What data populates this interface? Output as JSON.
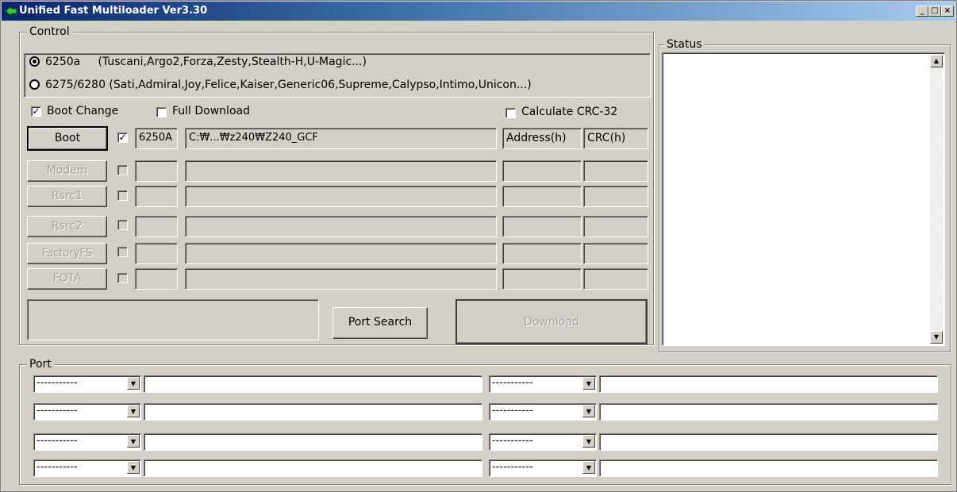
{
  "window": {
    "title": "Unified Fast Multiloader Ver3.30",
    "minimize": "_",
    "maximize": "□",
    "close": "×"
  },
  "control": {
    "legend": "Control",
    "radios": [
      {
        "label": "6250a     (Tuscani,Argo2,Forza,Zesty,Stealth-H,U-Magic...)",
        "selected": true
      },
      {
        "label": "6275/6280 (Sati,Admiral,Joy,Felice,Kaiser,Generic06,Supreme,Calypso,Intimo,Unicon...)",
        "selected": false
      }
    ],
    "boot_change": {
      "label": "Boot Change",
      "checked": true
    },
    "full_download": {
      "label": "Full Download",
      "checked": false
    },
    "calc_crc": {
      "label": "Calculate CRC-32",
      "checked": false
    },
    "header": {
      "address": "Address(h)",
      "crc": "CRC(h)"
    },
    "rows": [
      {
        "button": "Boot",
        "enabled": true,
        "checked": true,
        "chip": "6250A",
        "path": "C:₩...₩z240₩Z240_GCF",
        "address": "",
        "crc": ""
      },
      {
        "button": "Modem",
        "enabled": false,
        "checked": false,
        "chip": "",
        "path": "",
        "address": "",
        "crc": ""
      },
      {
        "button": "Rsrc1",
        "enabled": false,
        "checked": false,
        "chip": "",
        "path": "",
        "address": "",
        "crc": ""
      },
      {
        "button": "Rsrc2",
        "enabled": false,
        "checked": false,
        "chip": "",
        "path": "",
        "address": "",
        "crc": ""
      },
      {
        "button": "FactoryFS",
        "enabled": false,
        "checked": false,
        "chip": "",
        "path": "",
        "address": "",
        "crc": ""
      },
      {
        "button": "FOTA",
        "enabled": false,
        "checked": false,
        "chip": "",
        "path": "",
        "address": "",
        "crc": ""
      }
    ],
    "message": "",
    "port_search": "Port Search",
    "download": "Download"
  },
  "status": {
    "legend": "Status",
    "text": ""
  },
  "port": {
    "legend": "Port",
    "slots": [
      {
        "combo": "-----------",
        "value": ""
      },
      {
        "combo": "-----------",
        "value": ""
      },
      {
        "combo": "-----------",
        "value": ""
      },
      {
        "combo": "-----------",
        "value": ""
      },
      {
        "combo": "-----------",
        "value": ""
      },
      {
        "combo": "-----------",
        "value": ""
      },
      {
        "combo": "-----------",
        "value": ""
      },
      {
        "combo": "-----------",
        "value": ""
      }
    ]
  }
}
